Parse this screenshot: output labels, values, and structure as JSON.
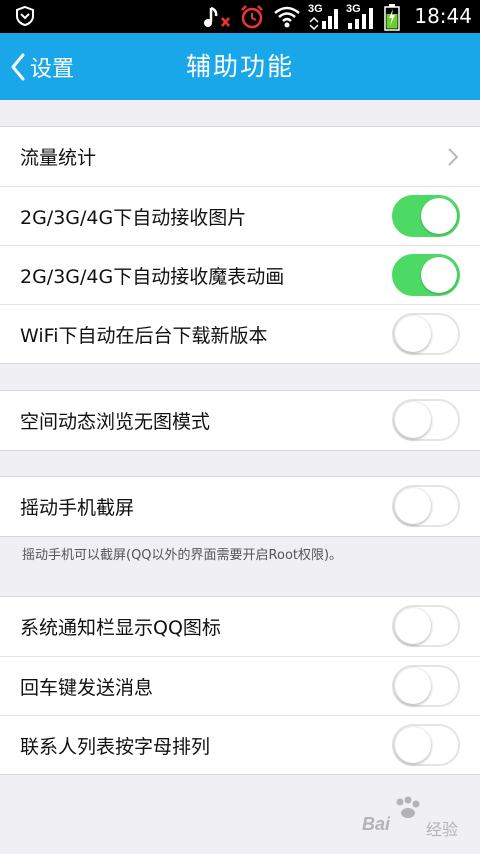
{
  "status_bar": {
    "time": "18:44",
    "net1": "3G",
    "net2": "3G",
    "icons": [
      "shield-icon",
      "music-note-icon",
      "alarm-clock-icon",
      "wifi-icon",
      "signal-icon",
      "battery-charging-icon"
    ]
  },
  "header": {
    "back_label": "设置",
    "title": "辅助功能"
  },
  "groups": [
    {
      "items": [
        {
          "label": "流量统计",
          "control": "chevron"
        },
        {
          "label": "2G/3G/4G下自动接收图片",
          "control": "toggle",
          "on": true
        },
        {
          "label": "2G/3G/4G下自动接收魔表动画",
          "control": "toggle",
          "on": true
        },
        {
          "label": "WiFi下自动在后台下载新版本",
          "control": "toggle",
          "on": false
        }
      ]
    },
    {
      "items": [
        {
          "label": "空间动态浏览无图模式",
          "control": "toggle",
          "on": false
        }
      ]
    },
    {
      "items": [
        {
          "label": "摇动手机截屏",
          "control": "toggle",
          "on": false
        }
      ],
      "hint": "摇动手机可以截屏(QQ以外的界面需要开启Root权限)。"
    },
    {
      "items": [
        {
          "label": "系统通知栏显示QQ图标",
          "control": "toggle",
          "on": false
        },
        {
          "label": "回车键发送消息",
          "control": "toggle",
          "on": false
        },
        {
          "label": "联系人列表按字母排列",
          "control": "toggle",
          "on": false
        }
      ]
    }
  ],
  "watermark": {
    "text": "Bai",
    "sub": "经验"
  },
  "colors": {
    "accent": "#1aa7ea",
    "toggle_on": "#4cd964",
    "background": "#efeff4"
  }
}
